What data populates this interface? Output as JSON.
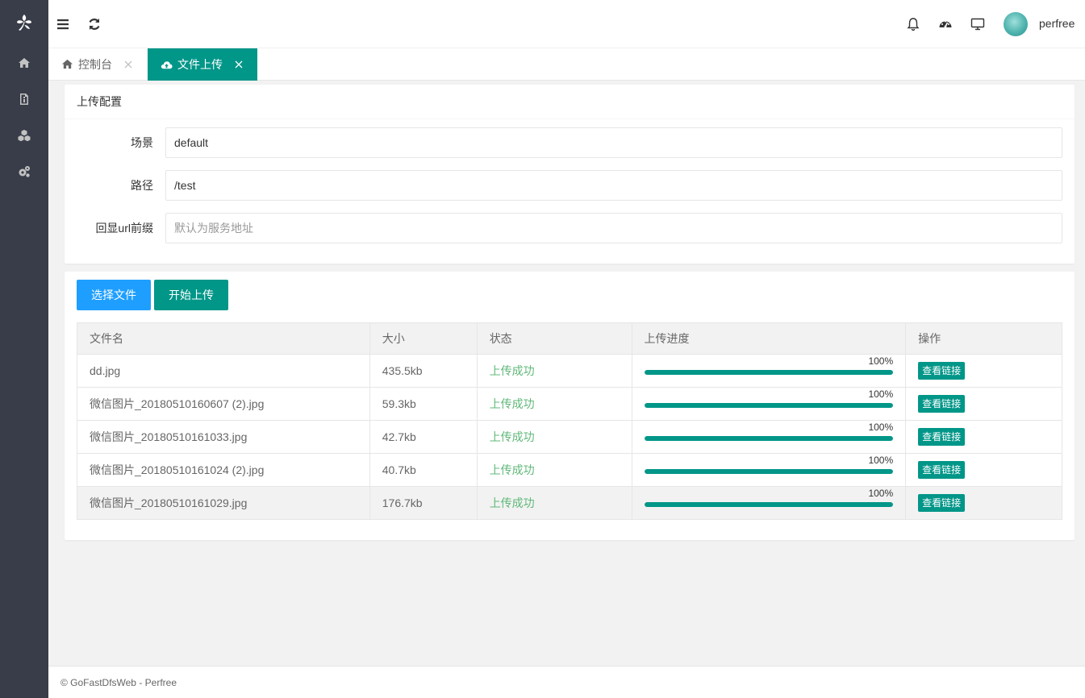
{
  "sidebar": {
    "logo": "leaf-logo",
    "items": [
      {
        "icon": "home-icon"
      },
      {
        "icon": "file-icon"
      },
      {
        "icon": "cubes-icon"
      },
      {
        "icon": "gears-icon"
      }
    ]
  },
  "header": {
    "username": "perfree",
    "icons": [
      "menu-icon",
      "refresh-icon",
      "bell-icon",
      "dashboard-icon",
      "monitor-icon"
    ]
  },
  "tabs": [
    {
      "label": "控制台",
      "icon": "home-icon",
      "active": false
    },
    {
      "label": "文件上传",
      "icon": "cloud-upload-icon",
      "active": true
    }
  ],
  "config": {
    "title": "上传配置",
    "fields": [
      {
        "label": "场景",
        "value": "default",
        "placeholder": ""
      },
      {
        "label": "路径",
        "value": "/test",
        "placeholder": ""
      },
      {
        "label": "回显url前缀",
        "value": "",
        "placeholder": "默认为服务地址"
      }
    ]
  },
  "upload": {
    "select_label": "选择文件",
    "start_label": "开始上传",
    "columns": [
      "文件名",
      "大小",
      "状态",
      "上传进度",
      "操作"
    ],
    "rows": [
      {
        "name": "dd.jpg",
        "size": "435.5kb",
        "status": "上传成功",
        "progress": "100%",
        "progress_value": 100,
        "action": "查看链接"
      },
      {
        "name": "微信图片_20180510160607 (2).jpg",
        "size": "59.3kb",
        "status": "上传成功",
        "progress": "100%",
        "progress_value": 100,
        "action": "查看链接"
      },
      {
        "name": "微信图片_20180510161033.jpg",
        "size": "42.7kb",
        "status": "上传成功",
        "progress": "100%",
        "progress_value": 100,
        "action": "查看链接"
      },
      {
        "name": "微信图片_20180510161024 (2).jpg",
        "size": "40.7kb",
        "status": "上传成功",
        "progress": "100%",
        "progress_value": 100,
        "action": "查看链接"
      },
      {
        "name": "微信图片_20180510161029.jpg",
        "size": "176.7kb",
        "status": "上传成功",
        "progress": "100%",
        "progress_value": 100,
        "action": "查看链接"
      }
    ]
  },
  "footer": {
    "text": "© GoFastDfsWeb - Perfree"
  },
  "colors": {
    "sidebar_bg": "#393d49",
    "accent": "#009688",
    "primary_blue": "#1e9fff",
    "success_text": "#5fb878"
  }
}
